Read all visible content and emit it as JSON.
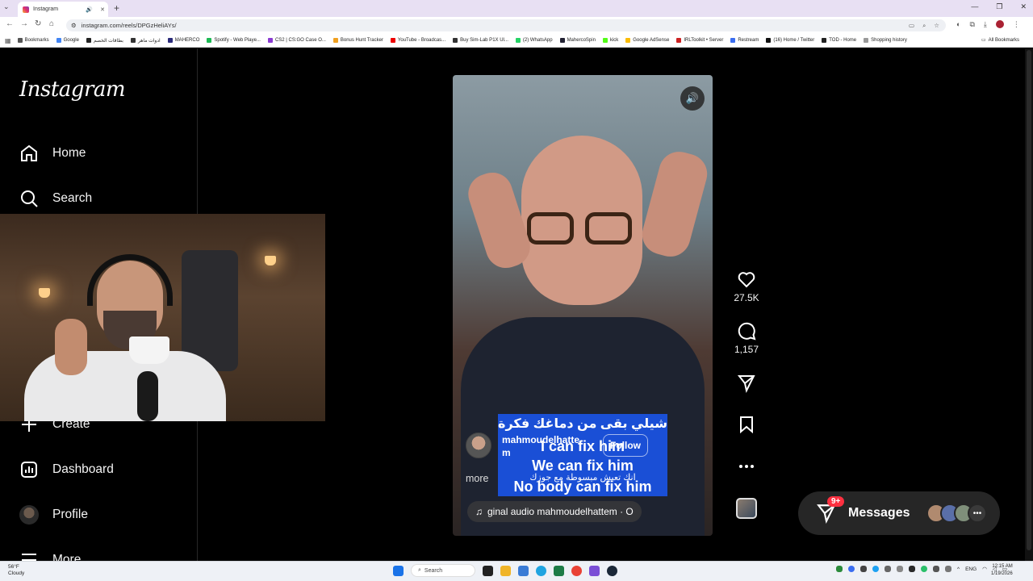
{
  "browser": {
    "tab_title": "Instagram",
    "new_tab": "+",
    "url": "instagram.com/reels/DPGzHeliAYs/",
    "bookmarks": [
      {
        "label": "Bookmarks",
        "color": "#555"
      },
      {
        "label": "Google",
        "color": "#4285f4"
      },
      {
        "label": "بطاقات الخصم",
        "color": "#222"
      },
      {
        "label": "ادوات ماهر",
        "color": "#333"
      },
      {
        "label": "MAHERCO",
        "color": "#2a2a7a"
      },
      {
        "label": "Spotify - Web Playe...",
        "color": "#1db954"
      },
      {
        "label": "CS2 | CS:GO Case O...",
        "color": "#8a3ad1"
      },
      {
        "label": "Bonus Hunt Tracker",
        "color": "#f0a020"
      },
      {
        "label": "YouTube - Broadcas...",
        "color": "#e00"
      },
      {
        "label": "Buy Sim-Lab P1X Ul...",
        "color": "#333"
      },
      {
        "label": "(2) WhatsApp",
        "color": "#25d366"
      },
      {
        "label": "MahercoSpin",
        "color": "#223"
      },
      {
        "label": "kick",
        "color": "#53fc18"
      },
      {
        "label": "Google AdSense",
        "color": "#fbbc04"
      },
      {
        "label": "IRLToolkit • Server",
        "color": "#c22"
      },
      {
        "label": "Restream",
        "color": "#3a6df0"
      },
      {
        "label": "(16) Home / Twitter",
        "color": "#111"
      },
      {
        "label": "TOD - Home",
        "color": "#222"
      },
      {
        "label": "Shopping history",
        "color": "#999"
      }
    ],
    "all_bookmarks": "All Bookmarks"
  },
  "sidebar": {
    "logo": "Instagram",
    "items": [
      {
        "label": "Home",
        "icon": "home-icon"
      },
      {
        "label": "Search",
        "icon": "search-icon"
      },
      {
        "label": "Create",
        "icon": "plus-icon"
      },
      {
        "label": "Dashboard",
        "icon": "dashboard-icon"
      },
      {
        "label": "Profile",
        "icon": "avatar"
      },
      {
        "label": "More",
        "icon": "menu-icon"
      }
    ]
  },
  "reel": {
    "subtitle_ar_top": "شيلي بقى من دماغك فكرة",
    "subtitle_en_1": "I can fix him",
    "subtitle_en_2": "We can fix him",
    "subtitle_ar_bottom": "انك تعيش مبسوطة مع جوزك",
    "subtitle_en_3": "No body can fix him",
    "username": "mahmoudelhatte m",
    "follow": "Follow",
    "more": "more",
    "audio": "ginal audio   mahmoudelhattem · O"
  },
  "actions": {
    "likes": "27.5K",
    "comments": "1,157"
  },
  "messages": {
    "label": "Messages",
    "badge": "9+"
  },
  "taskbar": {
    "temp": "56°F",
    "weather": "Cloudy",
    "search": "Search",
    "lang": "ENG",
    "time": "12:15 AM",
    "date": "1/19/2026"
  }
}
